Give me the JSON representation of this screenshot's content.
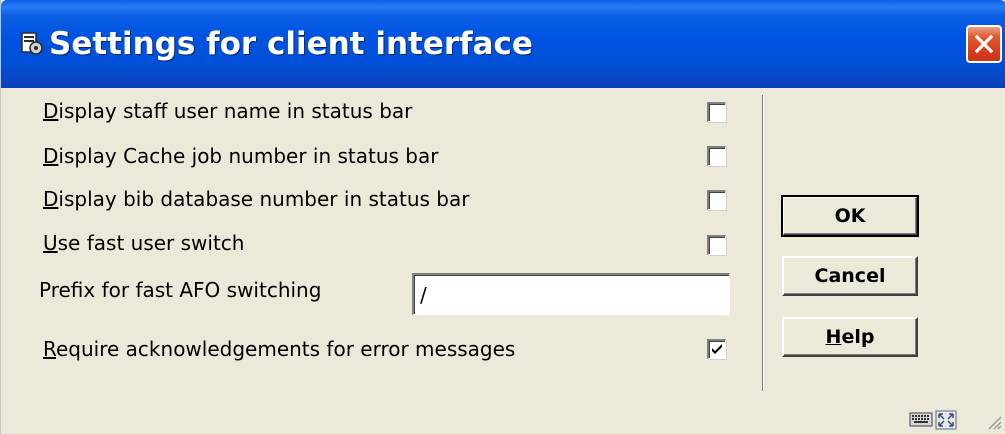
{
  "window": {
    "title": "Settings for client interface",
    "icon": "app-icon"
  },
  "settings": {
    "display_user_name": {
      "label_acc": "D",
      "label_rest": "isplay staff user name in status bar",
      "checked": false
    },
    "display_cache_job": {
      "label_acc": "D",
      "label_rest": "isplay Cache job number in status bar",
      "checked": false
    },
    "display_bib_db": {
      "label_acc": "D",
      "label_rest": "isplay bib database number in status bar",
      "checked": false
    },
    "fast_user_switch": {
      "label_acc": "U",
      "label_rest": "se fast user switch",
      "checked": false
    },
    "prefix": {
      "label": "Prefix for fast AFO switching",
      "value": "/"
    },
    "require_ack": {
      "label_acc": "R",
      "label_rest": "equire acknowledgements for error messages",
      "checked": true
    }
  },
  "buttons": {
    "ok": "OK",
    "cancel": "Cancel",
    "help_acc": "H",
    "help_rest": "elp"
  },
  "status_bar": {
    "icons": [
      "keyboard-icon",
      "resize-icon"
    ]
  }
}
